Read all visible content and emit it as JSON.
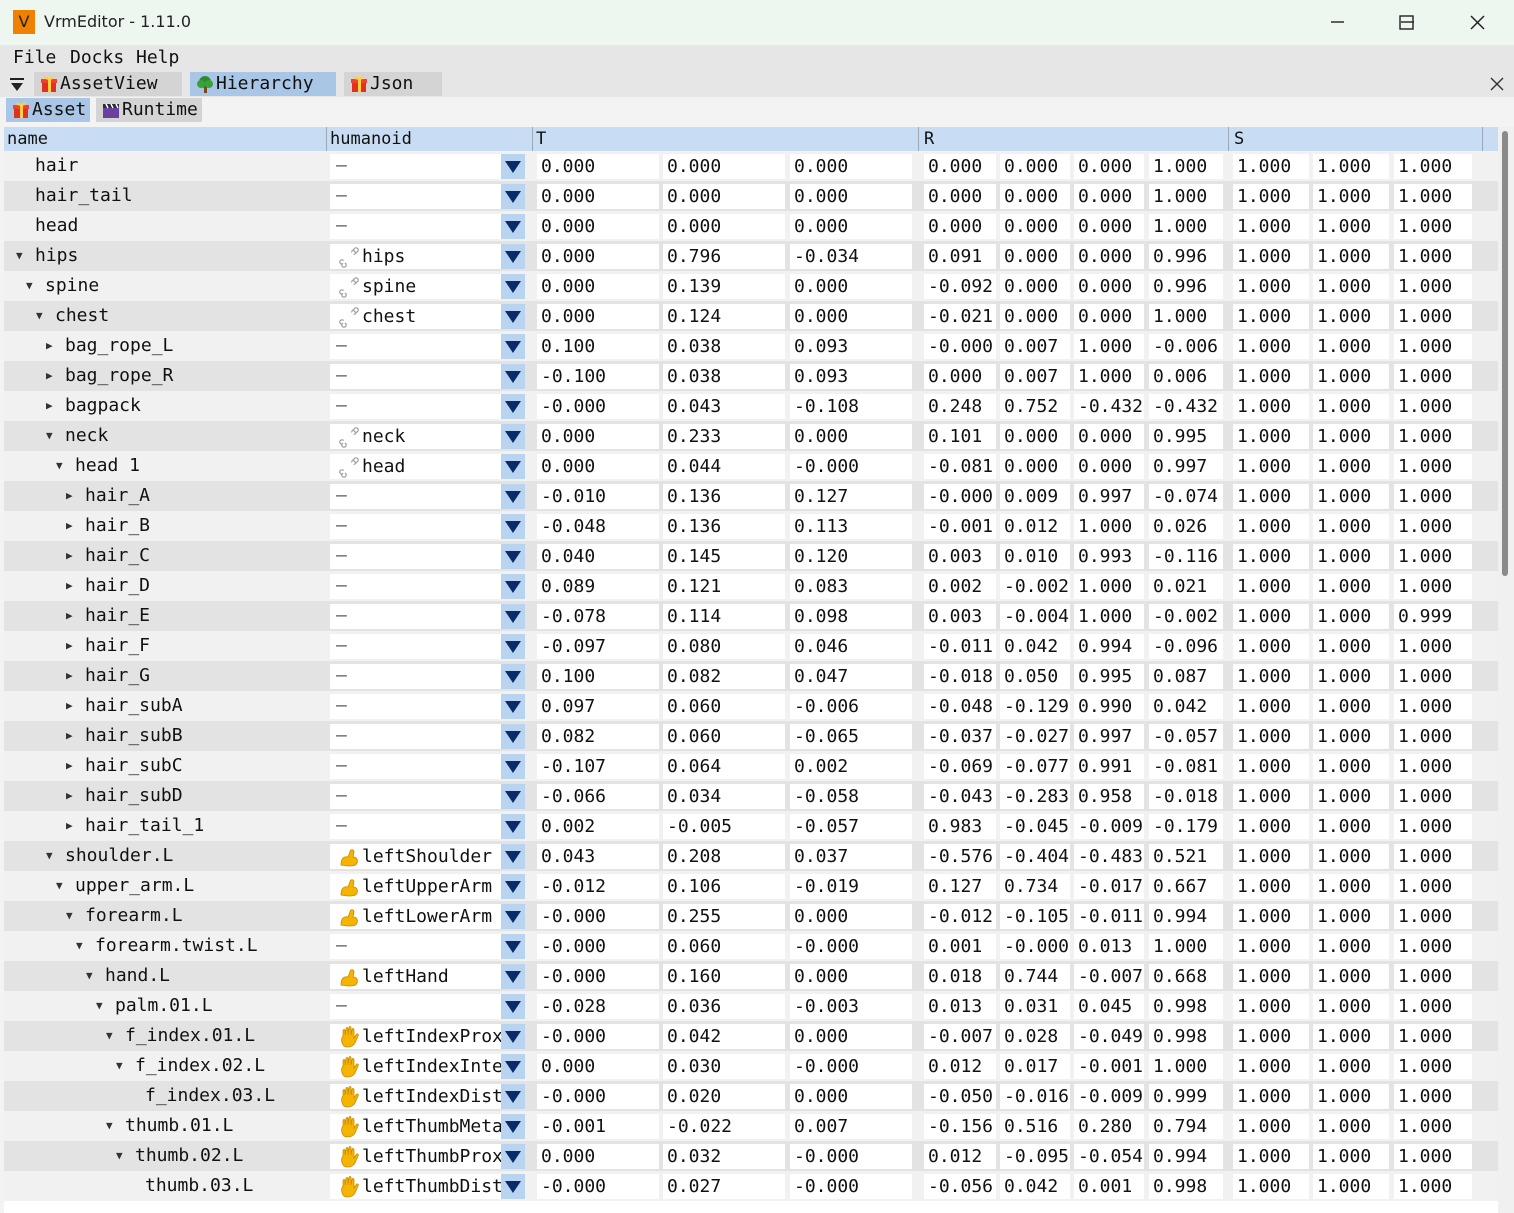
{
  "window": {
    "app_icon_letter": "V",
    "title": "VrmEditor - 1.11.0"
  },
  "menu": [
    "File",
    "Docks",
    "Help"
  ],
  "tabs": [
    {
      "label": "AssetView",
      "icon": "gift-icon",
      "active": false
    },
    {
      "label": "Hierarchy",
      "icon": "tree-icon",
      "active": true
    },
    {
      "label": "Json",
      "icon": "gift-icon",
      "active": false
    }
  ],
  "subtabs": [
    {
      "label": "Asset",
      "icon": "gift-icon",
      "active": true
    },
    {
      "label": "Runtime",
      "icon": "clapper-icon",
      "active": false
    }
  ],
  "columns": {
    "name": "name",
    "humanoid": "humanoid",
    "t": "T",
    "r": "R",
    "s": "S"
  },
  "colors": {
    "header_bg": "#c8ddf4",
    "active_tab": "#a9c6e6",
    "dropdown_btn": "#b8d4f0",
    "bone_hand": "#f5b400"
  },
  "rows": [
    {
      "name": "hair",
      "depth": 0,
      "arrow": "none",
      "humanoid": "",
      "icon": "none",
      "t": [
        "0.000",
        "0.000",
        "0.000"
      ],
      "r": [
        "0.000",
        "0.000",
        "0.000",
        "1.000"
      ],
      "s": [
        "1.000",
        "1.000",
        "1.000"
      ]
    },
    {
      "name": "hair_tail",
      "depth": 0,
      "arrow": "none",
      "humanoid": "",
      "icon": "none",
      "t": [
        "0.000",
        "0.000",
        "0.000"
      ],
      "r": [
        "0.000",
        "0.000",
        "0.000",
        "1.000"
      ],
      "s": [
        "1.000",
        "1.000",
        "1.000"
      ]
    },
    {
      "name": "head",
      "depth": 0,
      "arrow": "none",
      "humanoid": "",
      "icon": "none",
      "t": [
        "0.000",
        "0.000",
        "0.000"
      ],
      "r": [
        "0.000",
        "0.000",
        "0.000",
        "1.000"
      ],
      "s": [
        "1.000",
        "1.000",
        "1.000"
      ]
    },
    {
      "name": "hips",
      "depth": 0,
      "arrow": "down",
      "humanoid": "hips",
      "icon": "bone",
      "t": [
        "0.000",
        "0.796",
        "-0.034"
      ],
      "r": [
        "0.091",
        "0.000",
        "0.000",
        "0.996"
      ],
      "s": [
        "1.000",
        "1.000",
        "1.000"
      ]
    },
    {
      "name": "spine",
      "depth": 1,
      "arrow": "down",
      "humanoid": "spine",
      "icon": "bone",
      "t": [
        "0.000",
        "0.139",
        "0.000"
      ],
      "r": [
        "-0.092",
        "0.000",
        "0.000",
        "0.996"
      ],
      "s": [
        "1.000",
        "1.000",
        "1.000"
      ]
    },
    {
      "name": "chest",
      "depth": 2,
      "arrow": "down",
      "humanoid": "chest",
      "icon": "bone",
      "t": [
        "0.000",
        "0.124",
        "0.000"
      ],
      "r": [
        "-0.021",
        "0.000",
        "0.000",
        "1.000"
      ],
      "s": [
        "1.000",
        "1.000",
        "1.000"
      ]
    },
    {
      "name": "bag_rope_L",
      "depth": 3,
      "arrow": "right",
      "humanoid": "",
      "icon": "none",
      "t": [
        "0.100",
        "0.038",
        "0.093"
      ],
      "r": [
        "-0.000",
        "0.007",
        "1.000",
        "-0.006"
      ],
      "s": [
        "1.000",
        "1.000",
        "1.000"
      ]
    },
    {
      "name": "bag_rope_R",
      "depth": 3,
      "arrow": "right",
      "humanoid": "",
      "icon": "none",
      "t": [
        "-0.100",
        "0.038",
        "0.093"
      ],
      "r": [
        "0.000",
        "0.007",
        "1.000",
        "0.006"
      ],
      "s": [
        "1.000",
        "1.000",
        "1.000"
      ]
    },
    {
      "name": "bagpack",
      "depth": 3,
      "arrow": "right",
      "humanoid": "",
      "icon": "none",
      "t": [
        "-0.000",
        "0.043",
        "-0.108"
      ],
      "r": [
        "0.248",
        "0.752",
        "-0.432",
        "-0.432"
      ],
      "s": [
        "1.000",
        "1.000",
        "1.000"
      ]
    },
    {
      "name": "neck",
      "depth": 3,
      "arrow": "down",
      "humanoid": "neck",
      "icon": "bone",
      "t": [
        "0.000",
        "0.233",
        "0.000"
      ],
      "r": [
        "0.101",
        "0.000",
        "0.000",
        "0.995"
      ],
      "s": [
        "1.000",
        "1.000",
        "1.000"
      ]
    },
    {
      "name": "head 1",
      "depth": 4,
      "arrow": "down",
      "humanoid": "head",
      "icon": "bone",
      "t": [
        "0.000",
        "0.044",
        "-0.000"
      ],
      "r": [
        "-0.081",
        "0.000",
        "0.000",
        "0.997"
      ],
      "s": [
        "1.000",
        "1.000",
        "1.000"
      ]
    },
    {
      "name": "hair_A",
      "depth": 5,
      "arrow": "right",
      "humanoid": "",
      "icon": "none",
      "t": [
        "-0.010",
        "0.136",
        "0.127"
      ],
      "r": [
        "-0.000",
        "0.009",
        "0.997",
        "-0.074"
      ],
      "s": [
        "1.000",
        "1.000",
        "1.000"
      ]
    },
    {
      "name": "hair_B",
      "depth": 5,
      "arrow": "right",
      "humanoid": "",
      "icon": "none",
      "t": [
        "-0.048",
        "0.136",
        "0.113"
      ],
      "r": [
        "-0.001",
        "0.012",
        "1.000",
        "0.026"
      ],
      "s": [
        "1.000",
        "1.000",
        "1.000"
      ]
    },
    {
      "name": "hair_C",
      "depth": 5,
      "arrow": "right",
      "humanoid": "",
      "icon": "none",
      "t": [
        "0.040",
        "0.145",
        "0.120"
      ],
      "r": [
        "0.003",
        "0.010",
        "0.993",
        "-0.116"
      ],
      "s": [
        "1.000",
        "1.000",
        "1.000"
      ]
    },
    {
      "name": "hair_D",
      "depth": 5,
      "arrow": "right",
      "humanoid": "",
      "icon": "none",
      "t": [
        "0.089",
        "0.121",
        "0.083"
      ],
      "r": [
        "0.002",
        "-0.002",
        "1.000",
        "0.021"
      ],
      "s": [
        "1.000",
        "1.000",
        "1.000"
      ]
    },
    {
      "name": "hair_E",
      "depth": 5,
      "arrow": "right",
      "humanoid": "",
      "icon": "none",
      "t": [
        "-0.078",
        "0.114",
        "0.098"
      ],
      "r": [
        "0.003",
        "-0.004",
        "1.000",
        "-0.002"
      ],
      "s": [
        "1.000",
        "1.000",
        "0.999"
      ]
    },
    {
      "name": "hair_F",
      "depth": 5,
      "arrow": "right",
      "humanoid": "",
      "icon": "none",
      "t": [
        "-0.097",
        "0.080",
        "0.046"
      ],
      "r": [
        "-0.011",
        "0.042",
        "0.994",
        "-0.096"
      ],
      "s": [
        "1.000",
        "1.000",
        "1.000"
      ]
    },
    {
      "name": "hair_G",
      "depth": 5,
      "arrow": "right",
      "humanoid": "",
      "icon": "none",
      "t": [
        "0.100",
        "0.082",
        "0.047"
      ],
      "r": [
        "-0.018",
        "0.050",
        "0.995",
        "0.087"
      ],
      "s": [
        "1.000",
        "1.000",
        "1.000"
      ]
    },
    {
      "name": "hair_subA",
      "depth": 5,
      "arrow": "right",
      "humanoid": "",
      "icon": "none",
      "t": [
        "0.097",
        "0.060",
        "-0.006"
      ],
      "r": [
        "-0.048",
        "-0.129",
        "0.990",
        "0.042"
      ],
      "s": [
        "1.000",
        "1.000",
        "1.000"
      ]
    },
    {
      "name": "hair_subB",
      "depth": 5,
      "arrow": "right",
      "humanoid": "",
      "icon": "none",
      "t": [
        "0.082",
        "0.060",
        "-0.065"
      ],
      "r": [
        "-0.037",
        "-0.027",
        "0.997",
        "-0.057"
      ],
      "s": [
        "1.000",
        "1.000",
        "1.000"
      ]
    },
    {
      "name": "hair_subC",
      "depth": 5,
      "arrow": "right",
      "humanoid": "",
      "icon": "none",
      "t": [
        "-0.107",
        "0.064",
        "0.002"
      ],
      "r": [
        "-0.069",
        "-0.077",
        "0.991",
        "-0.081"
      ],
      "s": [
        "1.000",
        "1.000",
        "1.000"
      ]
    },
    {
      "name": "hair_subD",
      "depth": 5,
      "arrow": "right",
      "humanoid": "",
      "icon": "none",
      "t": [
        "-0.066",
        "0.034",
        "-0.058"
      ],
      "r": [
        "-0.043",
        "-0.283",
        "0.958",
        "-0.018"
      ],
      "s": [
        "1.000",
        "1.000",
        "1.000"
      ]
    },
    {
      "name": "hair_tail_1",
      "depth": 5,
      "arrow": "right",
      "humanoid": "",
      "icon": "none",
      "t": [
        "0.002",
        "-0.005",
        "-0.057"
      ],
      "r": [
        "0.983",
        "-0.045",
        "-0.009",
        "-0.179"
      ],
      "s": [
        "1.000",
        "1.000",
        "1.000"
      ]
    },
    {
      "name": "shoulder.L",
      "depth": 3,
      "arrow": "down",
      "humanoid": "leftShoulder",
      "icon": "arm",
      "t": [
        "0.043",
        "0.208",
        "0.037"
      ],
      "r": [
        "-0.576",
        "-0.404",
        "-0.483",
        "0.521"
      ],
      "s": [
        "1.000",
        "1.000",
        "1.000"
      ]
    },
    {
      "name": "upper_arm.L",
      "depth": 4,
      "arrow": "down",
      "humanoid": "leftUpperArm",
      "icon": "arm",
      "t": [
        "-0.012",
        "0.106",
        "-0.019"
      ],
      "r": [
        "0.127",
        "0.734",
        "-0.017",
        "0.667"
      ],
      "s": [
        "1.000",
        "1.000",
        "1.000"
      ]
    },
    {
      "name": "forearm.L",
      "depth": 5,
      "arrow": "down",
      "humanoid": "leftLowerArm",
      "icon": "arm",
      "t": [
        "-0.000",
        "0.255",
        "0.000"
      ],
      "r": [
        "-0.012",
        "-0.105",
        "-0.011",
        "0.994"
      ],
      "s": [
        "1.000",
        "1.000",
        "1.000"
      ]
    },
    {
      "name": "forearm.twist.L",
      "depth": 6,
      "arrow": "down",
      "humanoid": "",
      "icon": "none",
      "t": [
        "-0.000",
        "0.060",
        "-0.000"
      ],
      "r": [
        "0.001",
        "-0.000",
        "0.013",
        "1.000"
      ],
      "s": [
        "1.000",
        "1.000",
        "1.000"
      ]
    },
    {
      "name": "hand.L",
      "depth": 7,
      "arrow": "down",
      "humanoid": "leftHand",
      "icon": "arm",
      "t": [
        "-0.000",
        "0.160",
        "0.000"
      ],
      "r": [
        "0.018",
        "0.744",
        "-0.007",
        "0.668"
      ],
      "s": [
        "1.000",
        "1.000",
        "1.000"
      ]
    },
    {
      "name": "palm.01.L",
      "depth": 8,
      "arrow": "down",
      "humanoid": "",
      "icon": "none",
      "t": [
        "-0.028",
        "0.036",
        "-0.003"
      ],
      "r": [
        "0.013",
        "0.031",
        "0.045",
        "0.998"
      ],
      "s": [
        "1.000",
        "1.000",
        "1.000"
      ]
    },
    {
      "name": "f_index.01.L",
      "depth": 9,
      "arrow": "down",
      "humanoid": "leftIndexProxi",
      "icon": "hand",
      "t": [
        "-0.000",
        "0.042",
        "0.000"
      ],
      "r": [
        "-0.007",
        "0.028",
        "-0.049",
        "0.998"
      ],
      "s": [
        "1.000",
        "1.000",
        "1.000"
      ]
    },
    {
      "name": "f_index.02.L",
      "depth": 10,
      "arrow": "down",
      "humanoid": "leftIndexInter",
      "icon": "hand",
      "t": [
        "0.000",
        "0.030",
        "-0.000"
      ],
      "r": [
        "0.012",
        "0.017",
        "-0.001",
        "1.000"
      ],
      "s": [
        "1.000",
        "1.000",
        "1.000"
      ]
    },
    {
      "name": "f_index.03.L",
      "depth": 11,
      "arrow": "none",
      "humanoid": "leftIndexDista",
      "icon": "hand",
      "t": [
        "-0.000",
        "0.020",
        "0.000"
      ],
      "r": [
        "-0.050",
        "-0.016",
        "-0.009",
        "0.999"
      ],
      "s": [
        "1.000",
        "1.000",
        "1.000"
      ]
    },
    {
      "name": "thumb.01.L",
      "depth": 9,
      "arrow": "down",
      "humanoid": "leftThumbMetac",
      "icon": "hand",
      "t": [
        "-0.001",
        "-0.022",
        "0.007"
      ],
      "r": [
        "-0.156",
        "0.516",
        "0.280",
        "0.794"
      ],
      "s": [
        "1.000",
        "1.000",
        "1.000"
      ]
    },
    {
      "name": "thumb.02.L",
      "depth": 10,
      "arrow": "down",
      "humanoid": "leftThumbProxi",
      "icon": "hand",
      "t": [
        "0.000",
        "0.032",
        "-0.000"
      ],
      "r": [
        "0.012",
        "-0.095",
        "-0.054",
        "0.994"
      ],
      "s": [
        "1.000",
        "1.000",
        "1.000"
      ]
    },
    {
      "name": "thumb.03.L",
      "depth": 11,
      "arrow": "none",
      "humanoid": "leftThumbDista",
      "icon": "hand",
      "t": [
        "-0.000",
        "0.027",
        "-0.000"
      ],
      "r": [
        "-0.056",
        "0.042",
        "0.001",
        "0.998"
      ],
      "s": [
        "1.000",
        "1.000",
        "1.000"
      ]
    }
  ]
}
